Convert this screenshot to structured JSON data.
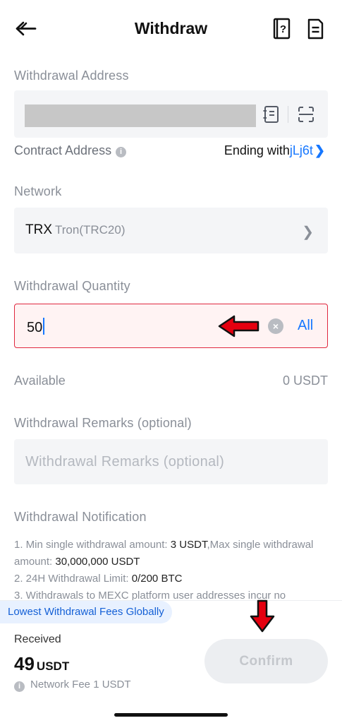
{
  "header": {
    "title": "Withdraw",
    "icons": [
      "back-arrow-icon",
      "help-book-icon",
      "record-document-icon"
    ]
  },
  "address": {
    "label": "Withdrawal Address",
    "icons": [
      "address-book-icon",
      "scan-icon"
    ]
  },
  "contract": {
    "label": "Contract Address",
    "ending_prefix": "Ending with",
    "ending_value": "jLj6t"
  },
  "network": {
    "label": "Network",
    "code": "TRX",
    "name": "Tron(TRC20)"
  },
  "quantity": {
    "label": "Withdrawal Quantity",
    "value": "50",
    "all_label": "All"
  },
  "available": {
    "label": "Available",
    "value": "0 USDT"
  },
  "remarks": {
    "label": "Withdrawal Remarks (optional)",
    "placeholder": "Withdrawal Remarks (optional)"
  },
  "notification": {
    "title": "Withdrawal Notification",
    "line1_a": "1. Min single withdrawal amount: ",
    "line1_b": "3 USDT",
    "line1_c": ",Max single withdrawal amount: ",
    "line1_d": "30,000,000 USDT",
    "line2_a": "2. 24H Withdrawal Limit: ",
    "line2_b": "0/200 BTC",
    "line3": "3. Withdrawals to MEXC platform user addresses incur no"
  },
  "promo": "Lowest Withdrawal Fees Globally",
  "received": {
    "label": "Received",
    "amount": "49",
    "unit": "USDT",
    "fee": "Network Fee 1 USDT"
  },
  "confirm_label": "Confirm",
  "colors": {
    "accent": "#1677ff",
    "error_border": "#e0283f",
    "annotation_arrow": "#e5000f"
  }
}
